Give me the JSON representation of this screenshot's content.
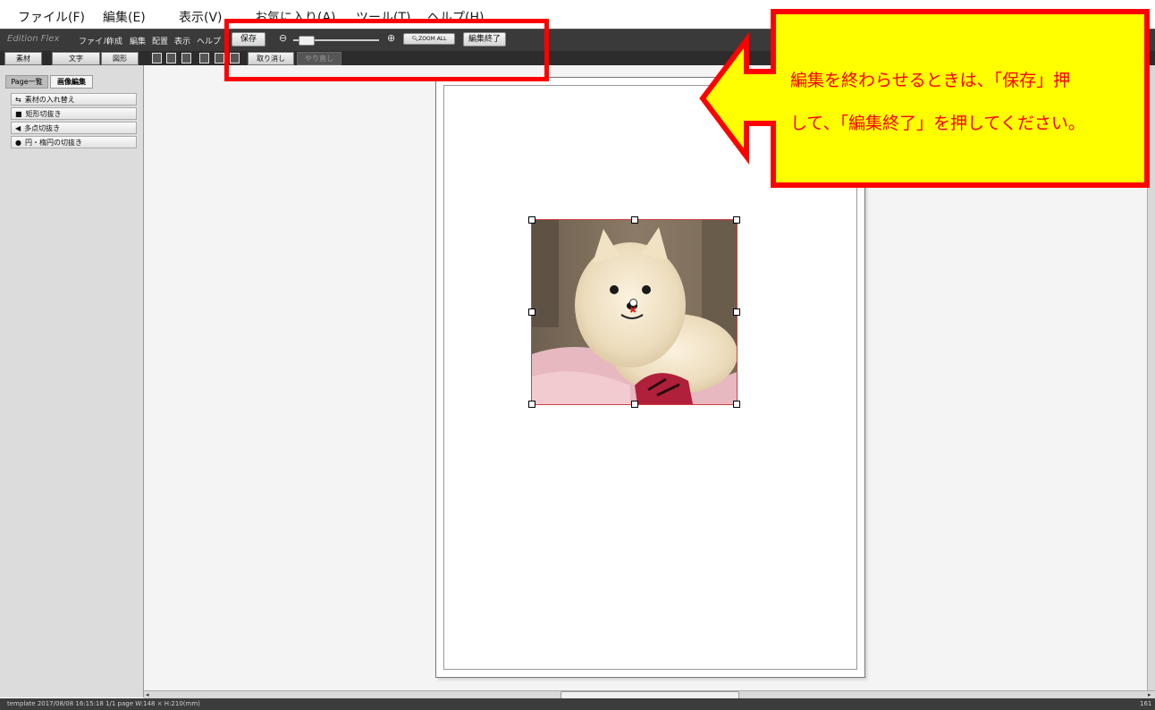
{
  "menubar": {
    "items": [
      "ファイル(F)",
      "編集(E)",
      "表示(V)",
      "お気に入り(A)",
      "ツール(T)",
      "ヘルプ(H)"
    ]
  },
  "app": {
    "brand": "Edition Flex",
    "menu": [
      "ファイル",
      "作成",
      "編集",
      "配置",
      "表示",
      "ヘルプ"
    ],
    "save_label": "保存",
    "zoom_all_label": "ZOOM ALL",
    "end_edit_label": "編集終了",
    "zoom_level": 0.15,
    "undo_label": "取り消し",
    "redo_label": "やり直し"
  },
  "tabs": [
    "素材",
    "文字",
    "図形"
  ],
  "panel": {
    "tabs": [
      "Page一覧",
      "画像編集"
    ],
    "items": [
      {
        "icon": "⇆",
        "label": "素材の入れ替え"
      },
      {
        "icon": "■",
        "label": "矩形切抜き"
      },
      {
        "icon": "◀",
        "label": "多点切抜き"
      },
      {
        "icon": "●",
        "label": "円・楕円の切抜き"
      }
    ]
  },
  "status": {
    "text": "template 2017/08/08 16:15:18  1/1 page W:148 × H:210(mm)",
    "right": "161"
  },
  "callout": {
    "line1": "編集を終わらせるときは、「保存」押",
    "line2": "して、「編集終了」を押してください。"
  },
  "colors": {
    "highlight": "#ff0000",
    "callout_fill": "#ffff00"
  }
}
